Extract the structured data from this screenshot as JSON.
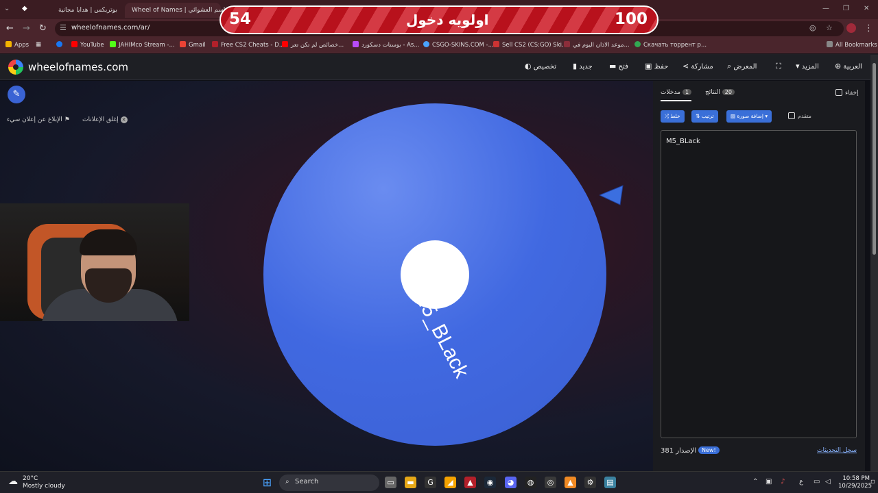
{
  "browser": {
    "tabs": [
      {
        "title": "بوتريكس | هدايا مجانية",
        "close": "✕"
      },
      {
        "title": "Wheel of Names | اسم العشوائي",
        "close": "✕"
      }
    ],
    "url": "wheelofnames.com/ar/",
    "window_controls": [
      "—",
      "❐",
      "✕"
    ],
    "bookmarks": [
      {
        "label": "Apps",
        "color": "#f4b400"
      },
      {
        "label": "YouTube",
        "color": "#ff0000"
      },
      {
        "label": "JAHIMco Stream -...",
        "color": "#53fc18"
      },
      {
        "label": "Gmail",
        "color": "#ea4335"
      },
      {
        "label": "Free CS2 Cheats - D...",
        "color": "#b3202a"
      },
      {
        "label": "خصائص لم تكن تعر...",
        "color": "#ff0000"
      },
      {
        "label": "بوستات دسكورد - As...",
        "color": "#b84cf7"
      },
      {
        "label": "CSGO-SKINS.COM -...",
        "color": "#4aa3ff"
      },
      {
        "label": "Sell CS2 (CS:GO) Ski...",
        "color": "#cc3333"
      },
      {
        "label": "موعد الاذان اليوم في...",
        "color": "#8b2d3a"
      },
      {
        "label": "Скачать торрент p...",
        "color": "#32a852"
      },
      {
        "label": "All Bookmarks",
        "color": "#888888"
      }
    ]
  },
  "overlay": {
    "left_number": "54",
    "title": "اولويه دخول",
    "right_number": "100"
  },
  "app": {
    "site_name": "wheelofnames.com",
    "menu": {
      "customize": "تخصيص",
      "new": "جديد",
      "open": "فتح",
      "save": "حفظ",
      "share": "مشاركة",
      "gallery": "المعرض",
      "more": "المزيد",
      "language": "العربية"
    },
    "ads": {
      "close_ads": "إغلق الإعلانات",
      "report_ad": "الإبلاغ عن إعلان سيء"
    },
    "wheel": {
      "segments": [
        "M5_BLack"
      ],
      "color": "#4169e1"
    },
    "panel": {
      "hide": "إخفاء",
      "tab_results": "النتائج",
      "results_count": "20",
      "tab_entries": "مدخلات",
      "entries_count": "1",
      "shuffle": "خلط",
      "sort": "ترتيب",
      "add_image": "إضافة صورة",
      "advanced": "متقدم",
      "entries": [
        "M5_BLack"
      ],
      "version_label": "الإصدار",
      "version_number": "381",
      "new_badge": "New!",
      "changelog": "سجل التحديثات"
    }
  },
  "taskbar": {
    "weather_temp": "20°C",
    "weather_desc": "Mostly cloudy",
    "search_placeholder": "Search",
    "time": "10:58 PM",
    "date": "10/29/2025",
    "lang": "ع"
  }
}
